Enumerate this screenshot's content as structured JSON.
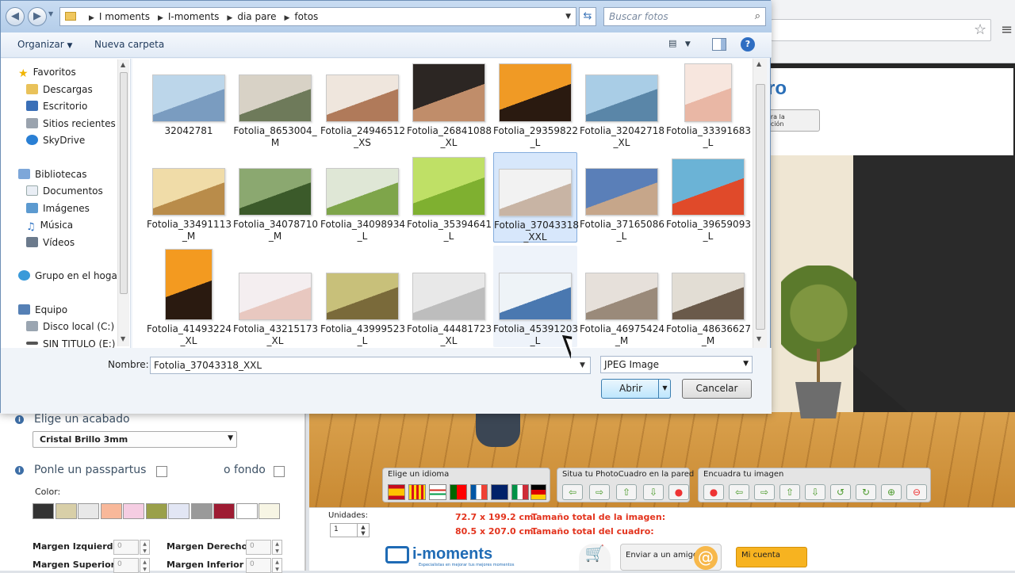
{
  "dialog": {
    "address": {
      "crumbs": [
        "I moments",
        "I-moments",
        "dia pare",
        "fotos"
      ]
    },
    "search": {
      "placeholder": "Buscar fotos"
    },
    "commands": {
      "organize": "Organizar",
      "new_folder": "Nueva carpeta"
    },
    "nav": {
      "favorites": "Favoritos",
      "downloads": "Descargas",
      "desktop": "Escritorio",
      "recent": "Sitios recientes",
      "skydrive": "SkyDrive",
      "libraries": "Bibliotecas",
      "documents": "Documentos",
      "images": "Imágenes",
      "music": "Música",
      "videos": "Vídeos",
      "homegroup": "Grupo en el hogar",
      "computer": "Equipo",
      "local_disk": "Disco local (C:)",
      "untitled": "SIN TITULO (E:)"
    },
    "files": [
      {
        "l1": "32042781",
        "l2": "",
        "c": "#bcd6ea",
        "c2": "#7a9cc0"
      },
      {
        "l1": "Fotolia_8653004_",
        "l2": "M",
        "c": "#d8d2c6",
        "c2": "#6e7a5a"
      },
      {
        "l1": "Fotolia_24946512",
        "l2": "_XS",
        "c": "#efe6dd",
        "c2": "#b07a5a"
      },
      {
        "l1": "Fotolia_26841088",
        "l2": "_XL",
        "c": "#2c2623",
        "c2": "#c08d6a"
      },
      {
        "l1": "Fotolia_29359822",
        "l2": "_L",
        "c": "#f09a25",
        "c2": "#2a1a10"
      },
      {
        "l1": "Fotolia_32042718",
        "l2": "_XL",
        "c": "#a9cde6",
        "c2": "#5a86a8"
      },
      {
        "l1": "Fotolia_33391683",
        "l2": "_L",
        "c": "#f7e6de",
        "c2": "#e9b7a5"
      },
      {
        "l1": "Fotolia_33491113",
        "l2": "_M",
        "c": "#f0dca8",
        "c2": "#b98c4a"
      },
      {
        "l1": "Fotolia_34078710",
        "l2": "_M",
        "c": "#8ba870",
        "c2": "#3b5a2a"
      },
      {
        "l1": "Fotolia_34098934",
        "l2": "_L",
        "c": "#dfe7d6",
        "c2": "#7ea54a"
      },
      {
        "l1": "Fotolia_35394641",
        "l2": "_L",
        "c": "#bfe066",
        "c2": "#7fb030"
      },
      {
        "l1": "Fotolia_37043318",
        "l2": "_XXL",
        "c": "#f2f2f2",
        "c2": "#c8b4a4"
      },
      {
        "l1": "Fotolia_37165086",
        "l2": "_L",
        "c": "#5a7fb8",
        "c2": "#c6a68a"
      },
      {
        "l1": "Fotolia_39659093",
        "l2": "_L",
        "c": "#6bb3d6",
        "c2": "#e04a2a"
      },
      {
        "l1": "Fotolia_41493224",
        "l2": "_XL",
        "c": "#f39a20",
        "c2": "#2a1a10"
      },
      {
        "l1": "Fotolia_43215173",
        "l2": "_XL",
        "c": "#f4eef0",
        "c2": "#e8c8c0"
      },
      {
        "l1": "Fotolia_43999523",
        "l2": "_L",
        "c": "#c8c07a",
        "c2": "#7a6a3a"
      },
      {
        "l1": "Fotolia_44481723",
        "l2": "_XL",
        "c": "#e8e8e8",
        "c2": "#bdbdbd"
      },
      {
        "l1": "Fotolia_45391203",
        "l2": "_L",
        "c": "#eef3f7",
        "c2": "#4a78b0"
      },
      {
        "l1": "Fotolia_46975424",
        "l2": "_M",
        "c": "#e6e0da",
        "c2": "#9a8a7a"
      },
      {
        "l1": "Fotolia_48636627",
        "l2": "_M",
        "c": "#e2ddd4",
        "c2": "#6a5a4a"
      }
    ],
    "name_label": "Nombre:",
    "file_name": "Fotolia_37043318_XXL",
    "file_type": "JPEG Image",
    "open_label": "Abrir",
    "cancel_label": "Cancelar"
  },
  "app": {
    "finish_title": "Elige un acabado",
    "finish_value": "Cristal Brillo 3mm",
    "passpartout_label": "Ponle un passpartus",
    "background_label": "o fondo",
    "color_label": "Color:",
    "swatches": [
      "#333333",
      "#d8cfa8",
      "#e8e8e8",
      "#f8b89a",
      "#f5cde2",
      "#9aa04a",
      "#e2e6f4",
      "#9a9a9a",
      "#9e1c33",
      "#ffffff",
      "#f7f5e4"
    ],
    "margin_left": "Margen Izquierdo",
    "margin_right": "Margen Derecho",
    "margin_top": "Margen Superior",
    "margin_bottom": "Margen Inferior",
    "margin_value": "0",
    "language_label": "Elige un idioma",
    "wall_label": "Situa tu PhotoCuadro en la pared",
    "frame_label": "Encuadra tu imagen",
    "units_label": "Unidades:",
    "units_value": "1",
    "image_size_value": "72.7 x 199.2 cm.",
    "image_size_label": "Tamaño total de la imagen:",
    "frame_size_value": "80.5 x 207.0 cm.",
    "frame_size_label": "Tamaño total del cuadro:",
    "logo_text": "i-moments",
    "logo_tagline": "Especialistas en mejorar tus mejores momentos",
    "email_label": "Enviar a un amigo",
    "account_label": "Mi cuenta",
    "room_logo_fragment": "ro",
    "room_button_fragment": "ora la\nación"
  },
  "colors": {
    "accent": "#2f6ec2",
    "selection": "#d7e7fb",
    "brand": "#1f6bb5",
    "size_text": "#e3341e"
  }
}
